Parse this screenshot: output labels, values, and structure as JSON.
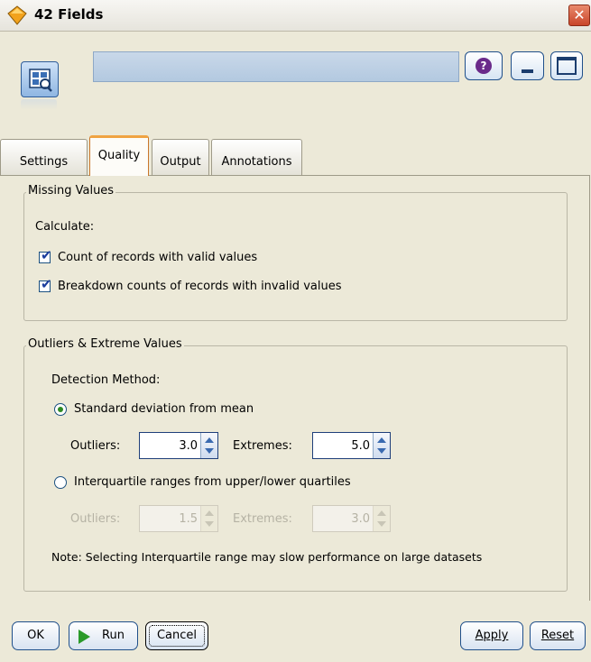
{
  "window": {
    "title": "42 Fields",
    "close_glyph": "✕"
  },
  "header": {
    "help_glyph": "?"
  },
  "tabs": [
    {
      "label": "Settings",
      "selected": false
    },
    {
      "label": "Quality",
      "selected": true
    },
    {
      "label": "Output",
      "selected": false
    },
    {
      "label": "Annotations",
      "selected": false
    }
  ],
  "missing_values": {
    "legend": "Missing Values",
    "calculate_label": "Calculate:",
    "count_valid": {
      "label": "Count of records with valid values",
      "checked": true
    },
    "breakdown_invalid": {
      "label": "Breakdown counts of records with invalid values",
      "checked": true
    }
  },
  "outliers": {
    "legend": "Outliers & Extreme Values",
    "detection_label": "Detection Method:",
    "std_dev": {
      "label": "Standard deviation from mean",
      "selected": true,
      "outliers_label": "Outliers:",
      "outliers_value": "3.0",
      "extremes_label": "Extremes:",
      "extremes_value": "5.0"
    },
    "iqr": {
      "label": "Interquartile ranges from upper/lower quartiles",
      "selected": false,
      "outliers_label": "Outliers:",
      "outliers_value": "1.5",
      "extremes_label": "Extremes:",
      "extremes_value": "3.0"
    },
    "note": "Note: Selecting Interquartile range may slow performance on large datasets"
  },
  "buttons": {
    "ok": "OK",
    "run": "Run",
    "cancel": "Cancel",
    "apply": "Apply",
    "reset": "Reset"
  },
  "colors": {
    "accent": "#1f4f8a",
    "selected_tab_border": "#f0a342",
    "run_icon": "#2a9a2a"
  }
}
